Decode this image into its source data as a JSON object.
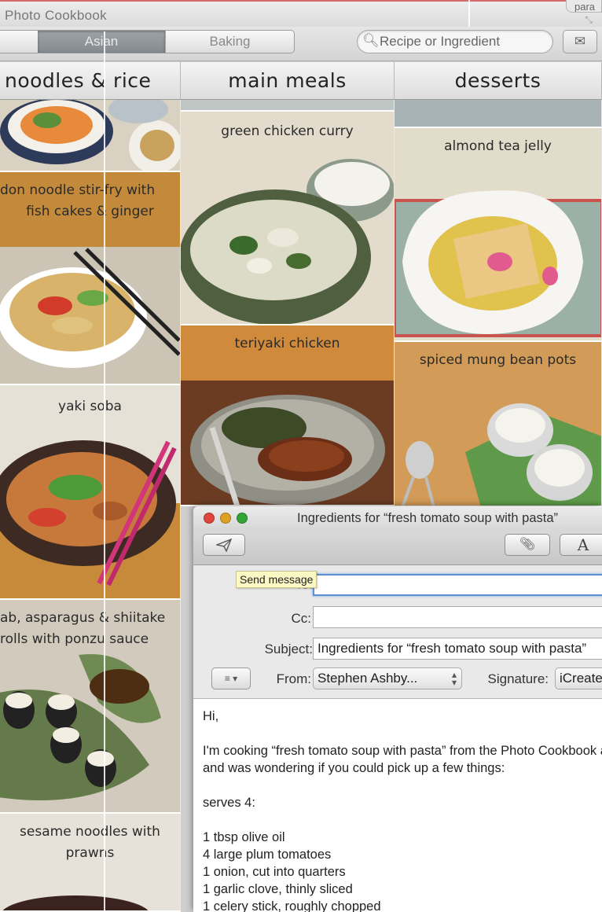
{
  "app": {
    "title": "Photo Cookbook",
    "corner_tab": "para"
  },
  "toolbar": {
    "tabs": [
      {
        "label": "Asian",
        "selected": true
      },
      {
        "label": "Baking",
        "selected": false
      }
    ],
    "search_placeholder": "Recipe or Ingredient",
    "mail_icon": "envelope-icon"
  },
  "columns": [
    {
      "title": "noodles & rice"
    },
    {
      "title": "main meals"
    },
    {
      "title": "desserts"
    }
  ],
  "recipes": {
    "udon_line1": "don noodle stir-fry with",
    "udon_line2": "fish cakes & ginger",
    "yaki": "yaki soba",
    "sushi_line1": "ab, asparagus & shiitake",
    "sushi_line2": "rolls with ponzu sauce",
    "sesame_line1": "sesame noodles with",
    "sesame_line2": "prawns",
    "green_curry": "green chicken curry",
    "teriyaki": "teriyaki chicken",
    "almond": "almond tea jelly",
    "mung": "spiced mung bean pots"
  },
  "compose": {
    "title": "Ingredients for “fresh tomato soup with pasta”",
    "tooltip": "Send message",
    "labels": {
      "to": "To:",
      "cc": "Cc:",
      "subject": "Subject:",
      "from": "From:",
      "signature": "Signature:"
    },
    "fields": {
      "to": "",
      "cc": "",
      "subject": "Ingredients for “fresh tomato soup with pasta”",
      "from": "Stephen Ashby...",
      "signature": "iCreate"
    },
    "attach_icon": "paperclip-icon",
    "format_label": "A",
    "body": {
      "greeting": "Hi,",
      "intro1": "I'm cooking “fresh tomato soup with pasta” from the Photo Cookbook app",
      "intro2": "and was wondering if you could pick up a few things:",
      "serves": "serves 4:",
      "items": [
        "1 tbsp olive oil",
        "4 large plum tomatoes",
        "1 onion, cut into quarters",
        "1 garlic clove, thinly sliced",
        "1 celery stick, roughly chopped"
      ]
    }
  },
  "colors": {
    "selected_tab": "#8f949a",
    "to_field_focus": "#5b8fd0",
    "close": "#e0443e",
    "minimize": "#dea123",
    "maximize": "#32a534"
  }
}
